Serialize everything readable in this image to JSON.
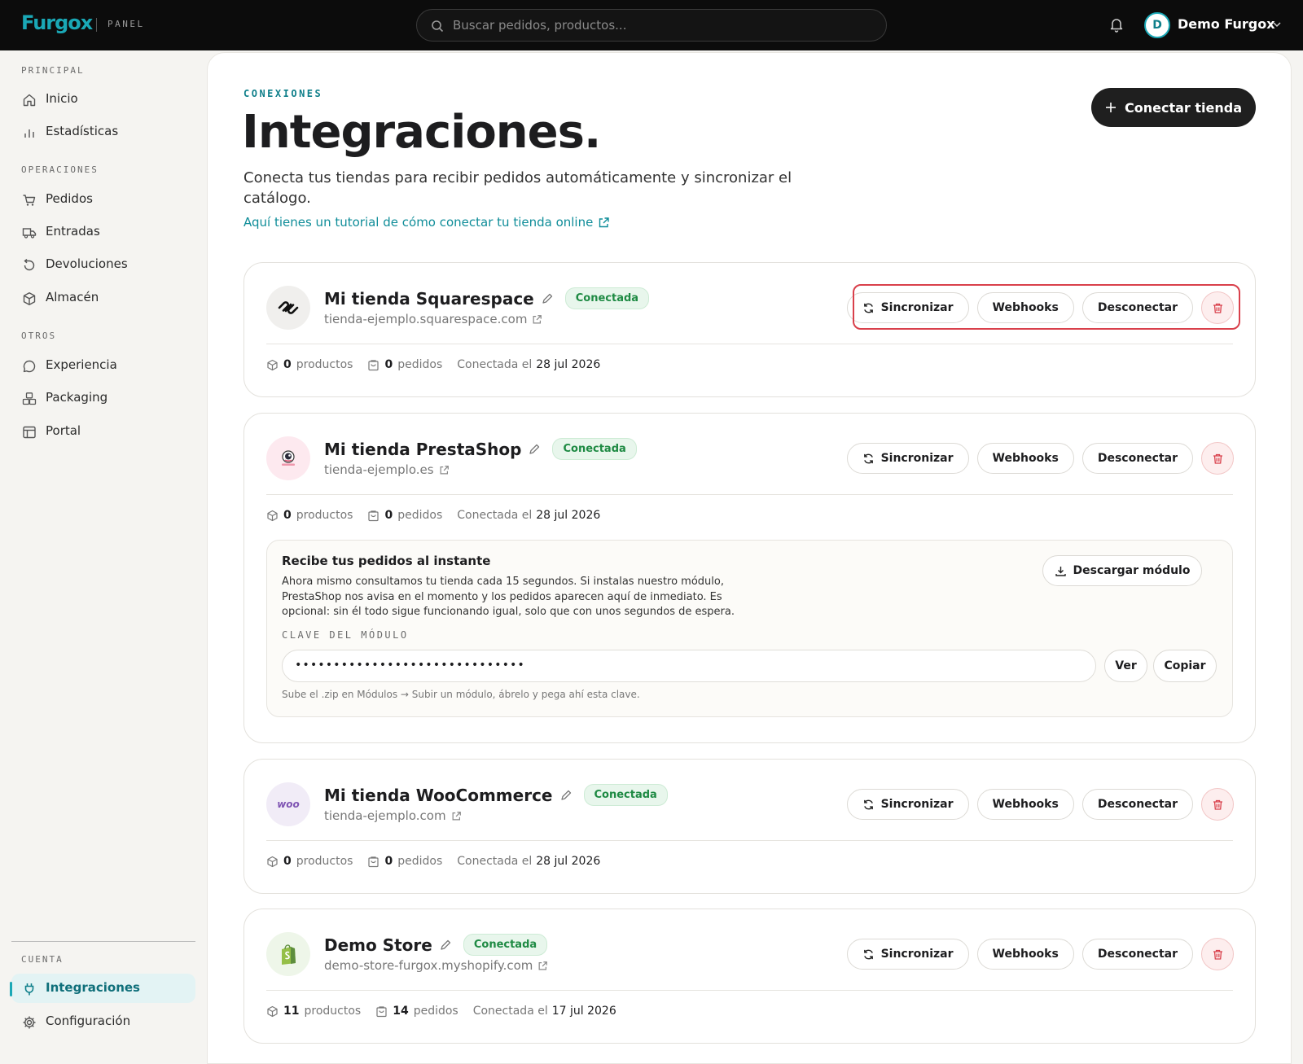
{
  "topbar": {
    "logo": "Furgox",
    "logo_tag": "PANEL",
    "search_placeholder": "Buscar pedidos, productos...",
    "user_initial": "D",
    "user_name": "Demo Furgox",
    "accent": "#1aa8b6"
  },
  "sidebar": {
    "sections": {
      "principal": "PRINCIPAL",
      "operaciones": "OPERACIONES",
      "otros": "OTROS",
      "cuenta": "CUENTA"
    },
    "items": [
      {
        "label": "Inicio",
        "icon": "home-icon"
      },
      {
        "label": "Estadísticas",
        "icon": "bar-chart-icon"
      },
      {
        "label": "Pedidos",
        "icon": "cart-icon"
      },
      {
        "label": "Entradas",
        "icon": "truck-icon"
      },
      {
        "label": "Devoluciones",
        "icon": "return-icon"
      },
      {
        "label": "Almacén",
        "icon": "box-icon"
      },
      {
        "label": "Experiencia",
        "icon": "chat-icon"
      },
      {
        "label": "Packaging",
        "icon": "packages-icon"
      },
      {
        "label": "Portal",
        "icon": "layout-icon"
      },
      {
        "label": "Integraciones",
        "icon": "plug-icon",
        "active": true
      },
      {
        "label": "Configuración",
        "icon": "gear-icon"
      }
    ]
  },
  "header": {
    "kicker": "CONEXIONES",
    "title": "Integraciones.",
    "description": "Conecta tus tiendas para recibir pedidos automáticamente y sincronizar el catálogo.",
    "tutorial_link": "Aquí tienes un tutorial de cómo conectar tu tienda online",
    "connect_button": "Conectar tienda"
  },
  "labels": {
    "sync": "Sincronizar",
    "webhooks": "Webhooks",
    "disconnect": "Desconectar",
    "products": "productos",
    "orders": "pedidos",
    "connected_on": "Conectada el"
  },
  "stores": [
    {
      "name": "Mi tienda Squarespace",
      "status": "Conectada",
      "url": "tienda-ejemplo.squarespace.com",
      "products": "0",
      "orders": "0",
      "date": "28 jul 2026",
      "platform": "squarespace"
    },
    {
      "name": "Mi tienda PrestaShop",
      "status": "Conectada",
      "url": "tienda-ejemplo.es",
      "products": "0",
      "orders": "0",
      "date": "28 jul 2026",
      "platform": "prestashop"
    },
    {
      "name": "Mi tienda WooCommerce",
      "status": "Conectada",
      "url": "tienda-ejemplo.com",
      "products": "0",
      "orders": "0",
      "date": "28 jul 2026",
      "platform": "woocommerce",
      "logo_text": "woo"
    },
    {
      "name": "Demo Store",
      "status": "Conectada",
      "url": "demo-store-furgox.myshopify.com",
      "products": "11",
      "orders": "14",
      "date": "17 jul 2026",
      "platform": "shopify"
    }
  ],
  "module": {
    "title": "Recibe tus pedidos al instante",
    "text": "Ahora mismo consultamos tu tienda cada 15 segundos. Si instalas nuestro módulo, PrestaShop nos avisa en el momento y los pedidos aparecen aquí de inmediato. Es opcional: sin él todo sigue funcionando igual, solo que con unos segundos de espera.",
    "download_button": "Descargar módulo",
    "key_label": "CLAVE DEL MÓDULO",
    "key_value": "••••••••••••••••••••••••••••••",
    "view_button": "Ver",
    "copy_button": "Copiar",
    "hint": "Sube el .zip en Módulos → Subir un módulo, ábrelo y pega ahí esta clave."
  }
}
